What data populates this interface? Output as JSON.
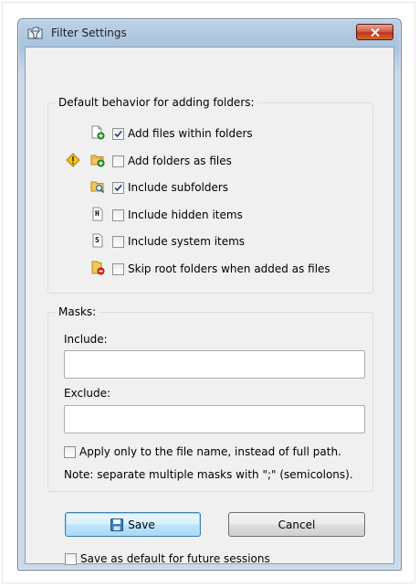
{
  "window": {
    "title": "Filter Settings"
  },
  "default_behavior": {
    "legend": "Default behavior for adding folders:",
    "options": [
      {
        "label": "Add files within folders",
        "checked": true,
        "icon": "file-add-icon"
      },
      {
        "label": "Add folders as files",
        "checked": false,
        "icon": "folder-add-icon",
        "warning_icon": "warning-icon"
      },
      {
        "label": "Include subfolders",
        "checked": true,
        "icon": "folder-search-icon"
      },
      {
        "label": "Include hidden items",
        "checked": false,
        "icon": "hidden-file-icon",
        "icon_letter": "H"
      },
      {
        "label": "Include system items",
        "checked": false,
        "icon": "system-file-icon",
        "icon_letter": "S"
      },
      {
        "label": "Skip root folders when added as files",
        "checked": false,
        "icon": "folder-remove-icon"
      }
    ]
  },
  "masks": {
    "legend": "Masks:",
    "include_label": "Include:",
    "include_value": "",
    "exclude_label": "Exclude:",
    "exclude_value": "",
    "apply_filename_label": "Apply only to the file name, instead of full path.",
    "apply_filename_checked": false,
    "note": "Note: separate multiple masks with \";\" (semicolons)."
  },
  "buttons": {
    "save": "Save",
    "cancel": "Cancel"
  },
  "save_default": {
    "label": "Save as default for future sessions",
    "checked": false
  }
}
